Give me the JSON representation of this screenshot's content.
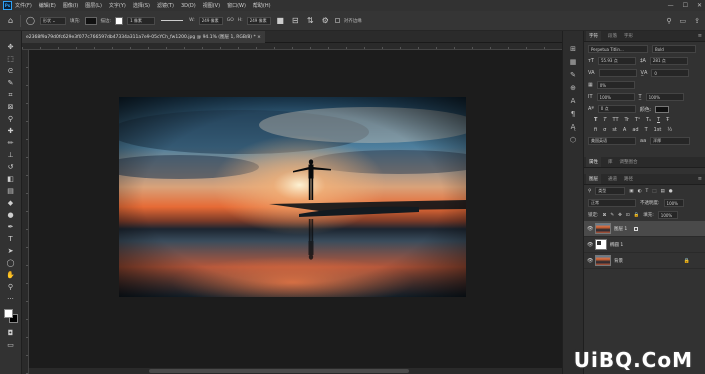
{
  "app": {
    "logo_text": "Ps"
  },
  "menubar": {
    "items": [
      "文件(F)",
      "编辑(E)",
      "图像(I)",
      "图层(L)",
      "文字(Y)",
      "选择(S)",
      "滤镜(T)",
      "3D(D)",
      "视图(V)",
      "窗口(W)",
      "帮助(H)"
    ],
    "window_controls": {
      "minimize": "—",
      "maximize": "☐",
      "close": "✕"
    }
  },
  "options_bar": {
    "mode_label": "形状",
    "fill_label": "填充:",
    "stroke_label": "描边:",
    "stroke_size": "1 像素",
    "w_label": "W:",
    "w_value": "249 像素",
    "go_label": "GO",
    "h_label": "H:",
    "h_value": "249 像素",
    "align_edges_label": "对齐边缘"
  },
  "document": {
    "tab_title": "e2368f9a79d0fc629e3f077c766597db47334a311a7e9-05cYCh_fw1200.jpg @ 94.1% (图层 1, RGB/8) *",
    "close": "×"
  },
  "toolbar": {
    "tools": [
      {
        "name": "move-tool",
        "glyph": "✥"
      },
      {
        "name": "marquee-tool",
        "glyph": "⬚"
      },
      {
        "name": "lasso-tool",
        "glyph": "ᘓ"
      },
      {
        "name": "quick-select-tool",
        "glyph": "✎"
      },
      {
        "name": "crop-tool",
        "glyph": "⌗"
      },
      {
        "name": "frame-tool",
        "glyph": "⊠"
      },
      {
        "name": "eyedropper-tool",
        "glyph": "⚲"
      },
      {
        "name": "healing-tool",
        "glyph": "✚"
      },
      {
        "name": "brush-tool",
        "glyph": "✏"
      },
      {
        "name": "stamp-tool",
        "glyph": "⊥"
      },
      {
        "name": "history-brush-tool",
        "glyph": "↺"
      },
      {
        "name": "eraser-tool",
        "glyph": "◧"
      },
      {
        "name": "gradient-tool",
        "glyph": "▤"
      },
      {
        "name": "blur-tool",
        "glyph": "◆"
      },
      {
        "name": "dodge-tool",
        "glyph": "●"
      },
      {
        "name": "pen-tool",
        "glyph": "✒"
      },
      {
        "name": "type-tool",
        "glyph": "T"
      },
      {
        "name": "path-select-tool",
        "glyph": "➤"
      },
      {
        "name": "shape-tool",
        "glyph": "◯"
      },
      {
        "name": "hand-tool",
        "glyph": "✋"
      },
      {
        "name": "zoom-tool",
        "glyph": "⚲"
      },
      {
        "name": "more-tools",
        "glyph": "···"
      }
    ]
  },
  "character_panel": {
    "tabs": [
      "字符",
      "段落",
      "字形"
    ],
    "font_family": "Perpetua Titlin...",
    "font_style": "Bold",
    "font_size": "55.93 点",
    "leading": "281 点",
    "kerning": "VA",
    "tracking": "0",
    "scale_pct": "0%",
    "vertical_scale": "100%",
    "horizontal_scale": "100%",
    "baseline": "0 点",
    "color_label": "颜色:",
    "style_glyphs": [
      "T",
      "T",
      "TT",
      "Tr",
      "T¹",
      "T₁",
      "T",
      "Ŧ"
    ],
    "ot_glyphs": [
      "fi",
      "σ",
      "st",
      "A",
      "ad",
      "T",
      "1st",
      "½"
    ],
    "language": "美国英语",
    "antialias_icon": "aa",
    "antialias": "浑厚"
  },
  "properties_tabs": [
    "属性",
    "库",
    "调整图合"
  ],
  "layers_panel": {
    "tabs": [
      "图层",
      "通道",
      "路径"
    ],
    "kind_label": "类型",
    "blend_mode": "正常",
    "opacity_label": "不透明度:",
    "opacity_value": "100%",
    "lock_label": "锁定:",
    "fill_label": "填充:",
    "fill_value": "100%",
    "layers": [
      {
        "name": "图层 1",
        "selected": true
      },
      {
        "name": "椭圆 1",
        "selected": false
      },
      {
        "name": "背景",
        "selected": false
      }
    ]
  },
  "colors": {
    "accent": "#2fa3f7",
    "selected_layer": "#4a4a4a"
  },
  "watermark": "UiBQ.CoM"
}
